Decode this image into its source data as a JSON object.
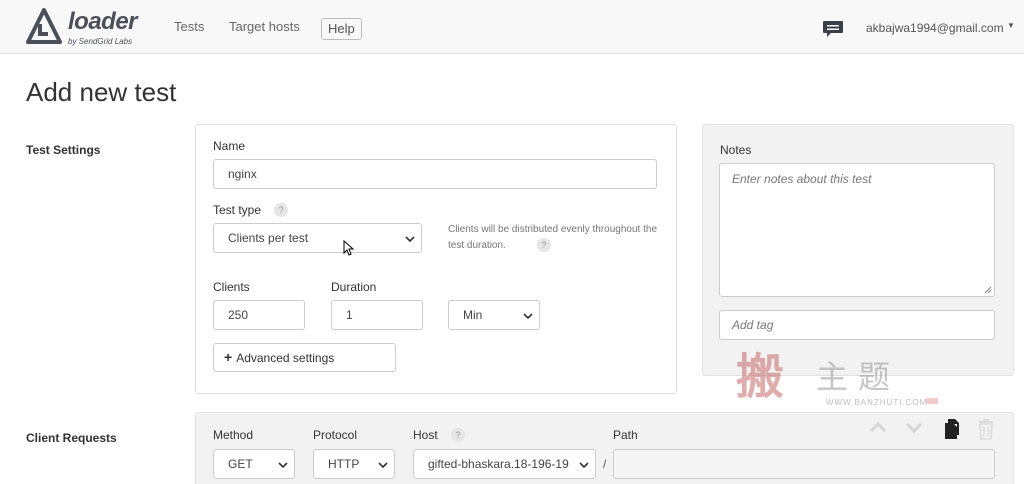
{
  "navbar": {
    "logo_name": "loader",
    "logo_sub": "by SendGrid Labs",
    "links": [
      "Tests",
      "Target hosts"
    ],
    "help_label": "Help",
    "user_email": "akbajwa1994@gmail.com",
    "chat_icon": "chat-icon",
    "caret_icon": "caret-down-icon"
  },
  "page": {
    "title": "Add new test"
  },
  "test_settings": {
    "section_label": "Test Settings",
    "name_label": "Name",
    "name_value": "nginx",
    "test_type_label": "Test type",
    "help_glyph": "?",
    "test_type_value": "Clients per test",
    "hint": "Clients will be distributed evenly throughout the test duration.",
    "clients_label": "Clients",
    "clients_value": "250",
    "duration_label": "Duration",
    "duration_value": "1",
    "unit_value": "Min",
    "advanced_label": "Advanced settings",
    "advanced_plus": "+"
  },
  "notes": {
    "label": "Notes",
    "placeholder": "Enter notes about this test",
    "tag_placeholder": "Add tag"
  },
  "client_requests": {
    "section_label": "Client Requests",
    "method_label": "Method",
    "method_value": "GET",
    "protocol_label": "Protocol",
    "protocol_value": "HTTP",
    "host_label": "Host",
    "host_value": "gifted-bhaskara.18-196-19",
    "separator": "/",
    "path_label": "Path",
    "path_value": "",
    "icons": [
      "arrow-up-icon",
      "arrow-down-icon",
      "copy-icon",
      "trash-icon"
    ]
  },
  "watermark": {
    "big_char": "搬",
    "text": "主题",
    "url": "WWW.BANZHUTI.COM"
  },
  "colors": {
    "navbar_bg": "#f8f8f8",
    "panel_gray": "#f2f2f2",
    "text": "#333333"
  }
}
